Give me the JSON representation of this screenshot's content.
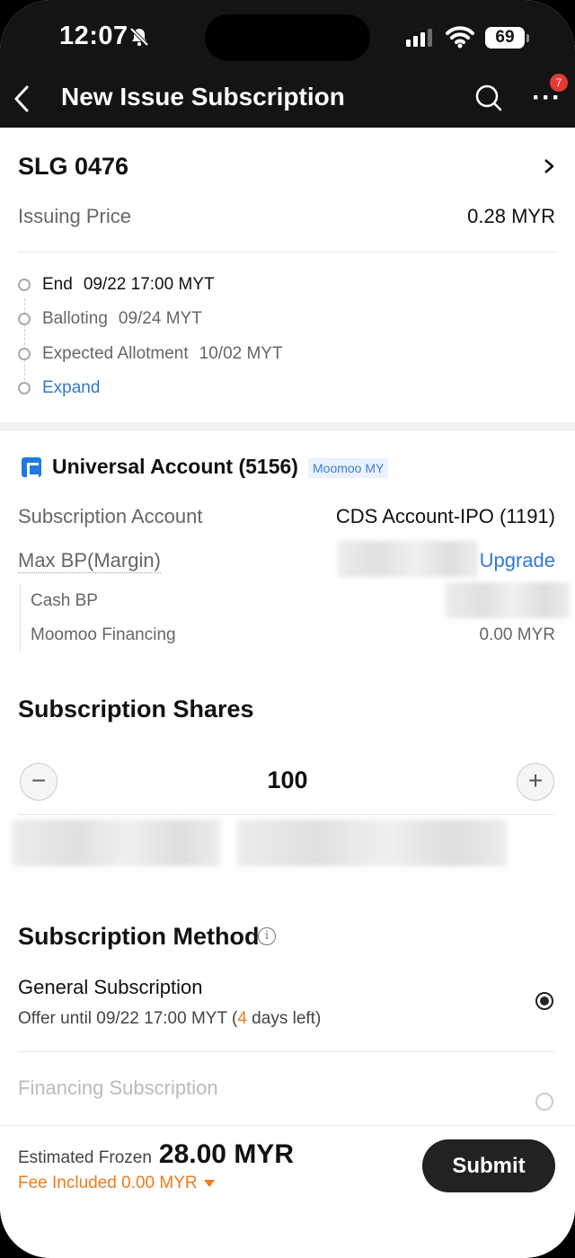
{
  "status_bar": {
    "time": "12:07",
    "battery": "69"
  },
  "header": {
    "title": "New Issue Subscription",
    "badge_count": "7"
  },
  "stock": {
    "symbol": "SLG 0476",
    "price_label": "Issuing Price",
    "price_value": "0.28 MYR"
  },
  "timeline": [
    {
      "label": "End",
      "value": "09/22 17:00 MYT"
    },
    {
      "label": "Balloting",
      "value": "09/24 MYT"
    },
    {
      "label": "Expected Allotment",
      "value": "10/02 MYT"
    }
  ],
  "expand_label": "Expand",
  "account": {
    "name": "Universal Account (5156)",
    "tag": "Moomoo MY",
    "subscription_account_label": "Subscription Account",
    "subscription_account_value": "CDS Account-IPO (1191)",
    "max_bp_label": "Max BP(Margin)",
    "upgrade_label": "Upgrade",
    "cash_bp_label": "Cash BP",
    "financing_label": "Moomoo Financing",
    "financing_value": "0.00 MYR"
  },
  "shares": {
    "heading": "Subscription Shares",
    "quantity": "100",
    "minus": "−",
    "plus": "+"
  },
  "method": {
    "heading": "Subscription Method",
    "general_title": "General Subscription",
    "general_offer_prefix": "Offer until 09/22 17:00 MYT (",
    "general_days": "4",
    "general_offer_suffix": " days left)",
    "financing_title": "Financing Subscription"
  },
  "footer": {
    "estimated_label": "Estimated Frozen",
    "estimated_value": "28.00 MYR",
    "fee_label": "Fee Included 0.00 MYR",
    "submit_label": "Submit"
  },
  "colors": {
    "accent_blue": "#1f7ae0",
    "link_blue": "#2f79d4",
    "orange": "#f07b1d",
    "header_bg": "#141414"
  }
}
